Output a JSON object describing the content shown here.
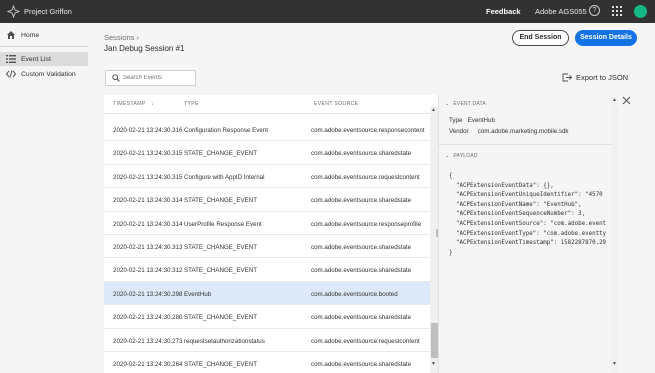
{
  "topbar": {
    "app_title": "Project Griffon",
    "feedback": "Feedback",
    "org": "Adobe AGS055",
    "help": "?"
  },
  "sidebar": {
    "items": [
      {
        "label": "Home",
        "icon": "home-icon"
      },
      {
        "label": "Event List",
        "icon": "list-icon"
      },
      {
        "label": "Custom Validation",
        "icon": "code-icon"
      }
    ]
  },
  "header": {
    "breadcrumb": "Sessions  ›",
    "session_title": "Jan Debug Session #1",
    "end_session": "End Session",
    "session_details": "Session Details"
  },
  "search": {
    "placeholder": "Search Events"
  },
  "export": {
    "label": "Export to JSON"
  },
  "table": {
    "columns": [
      "TIMESTAMP",
      "TYPE",
      "EVENT SOURCE"
    ],
    "sort_indicator": "↓",
    "rows": [
      {
        "ts": "2020-02-21 13:24:30.316",
        "type": "Configuration Response Event",
        "source": "com.adobe.eventsource.responsecontent"
      },
      {
        "ts": "2020-02-21 13:24:30.315",
        "type": "STATE_CHANGE_EVENT",
        "source": "com.adobe.eventsource.sharedstate"
      },
      {
        "ts": "2020-02-21 13:24:30.315",
        "type": "Configure with AppID Internal",
        "source": "com.adobe.eventsource.requestcontent"
      },
      {
        "ts": "2020-02-21 13:24:30.314",
        "type": "STATE_CHANGE_EVENT",
        "source": "com.adobe.eventsource.sharedstate"
      },
      {
        "ts": "2020-02-21 13:24:30.314",
        "type": "UserProfile Response Event",
        "source": "com.adobe.eventsource.responseprofile"
      },
      {
        "ts": "2020-02-21 13:24:30.313",
        "type": "STATE_CHANGE_EVENT",
        "source": "com.adobe.eventsource.sharedstate"
      },
      {
        "ts": "2020-02-21 13:24:30.312",
        "type": "STATE_CHANGE_EVENT",
        "source": "com.adobe.eventsource.sharedstate"
      },
      {
        "ts": "2020-02-21 13:24:30.298",
        "type": "EventHub",
        "source": "com.adobe.eventsource.booted"
      },
      {
        "ts": "2020-02-21 13:24:30.280",
        "type": "STATE_CHANGE_EVENT",
        "source": "com.adobe.eventsource.sharedstate"
      },
      {
        "ts": "2020-02-21 13:24:30.273",
        "type": "requestsetauthorizationstatus",
        "source": "com.adobe.eventsource.requestcontent"
      },
      {
        "ts": "2020-02-21 13:24:30.264",
        "type": "STATE_CHANGE_EVENT",
        "source": "com.adobe.eventsource.sharedstate"
      }
    ],
    "selected_index": 7
  },
  "detail": {
    "event_data_title": "EVENT DATA",
    "type_label": "Type",
    "type_value": "EventHub",
    "vendor_label": "Vendor",
    "vendor_value": "com.adobe.marketing.mobile.sdk",
    "payload_title": "PAYLOAD",
    "payload": "{\n  \"ACPExtensionEventData\": {},\n  \"ACPExtensionEventUniqueIdentifier\": \"4570\n  \"ACPExtensionEventName\": \"EventHub\",\n  \"ACPExtensionEventSequenceNumber\": 3,\n  \"ACPExtensionEventSource\": \"com.adobe.event\n  \"ACPExtensionEventType\": \"com.adobe.eventty\n  \"ACPExtensionEventTimestamp\": 1582287870.29\n}"
  },
  "colors": {
    "accent": "#1473e6",
    "topbar": "#323232",
    "selected_row": "#dde9f8",
    "avatar": "#12b886"
  }
}
